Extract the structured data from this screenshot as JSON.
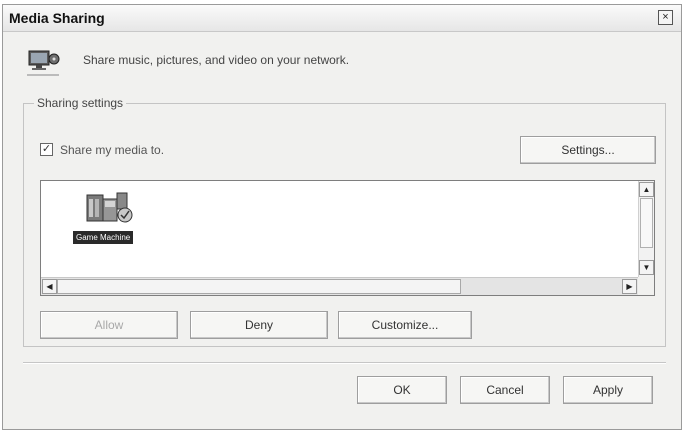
{
  "window": {
    "title": "Media Sharing",
    "close_label": "×"
  },
  "header": {
    "icon": "media-sharing-icon",
    "text": "Share music, pictures, and video on your network."
  },
  "sharing_settings": {
    "group_label": "Sharing settings",
    "share_checkbox": {
      "label": "Share my media to.",
      "checked": true
    },
    "settings_button": "Settings...",
    "devices": [
      {
        "label": "Game Machine",
        "icon": "media-device-icon"
      }
    ],
    "action_buttons": [
      {
        "label": "Allow",
        "enabled": false
      },
      {
        "label": "Deny",
        "enabled": true
      },
      {
        "label": "Customize...",
        "enabled": true
      }
    ]
  },
  "footer_buttons": {
    "ok": "OK",
    "cancel": "Cancel",
    "apply": "Apply"
  }
}
